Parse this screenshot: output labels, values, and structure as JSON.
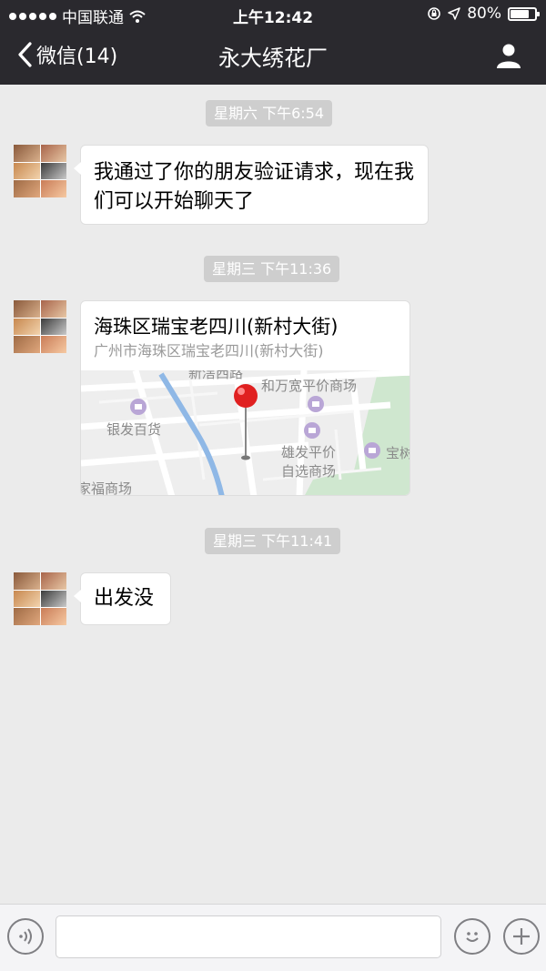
{
  "status_bar": {
    "carrier": "中国联通",
    "time": "上午12:42",
    "battery_percent": "80%",
    "battery_level": 0.8
  },
  "nav": {
    "back_label": "微信(14)",
    "title": "永大绣花厂",
    "icons": {
      "back": "chevron-left-icon",
      "profile": "person-icon"
    }
  },
  "messages": [
    {
      "time": "星期六 下午6:54",
      "text": "我通过了你的朋友验证请求，现在我们可以开始聊天了"
    },
    {
      "time": "星期三 下午11:36",
      "location": {
        "name": "海珠区瑞宝老四川(新村大街)",
        "address": "广州市海珠区瑞宝老四川(新村大街)",
        "map_labels": [
          "新滘西路",
          "和万宽平价商场",
          "银发百货",
          "雄发平价",
          "自选商场",
          "宝树",
          "家福商场"
        ]
      }
    },
    {
      "time": "星期三 下午11:41",
      "text": "出发没"
    }
  ],
  "input_bar": {
    "icons": {
      "voice": "voice-icon",
      "emoji": "emoji-icon",
      "more": "plus-icon"
    }
  },
  "colors": {
    "nav_bg": "#2a292e",
    "chat_bg": "#ebebeb",
    "time_badge": "#cecece",
    "pin": "#e02020"
  }
}
